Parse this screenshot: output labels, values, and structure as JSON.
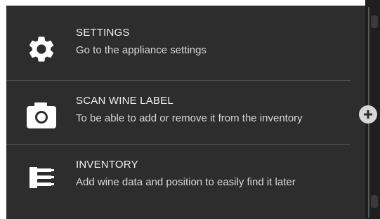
{
  "menu": {
    "items": [
      {
        "id": "settings",
        "title": "SETTINGS",
        "description": "Go to the appliance settings",
        "icon": "gear-icon"
      },
      {
        "id": "scan",
        "title": "SCAN WINE LABEL",
        "description": "To be able to add or remove it from the inventory",
        "icon": "camera-icon"
      },
      {
        "id": "inventory",
        "title": "INVENTORY",
        "description": "Add wine data and position to easily find it later",
        "icon": "wine-rack-icon"
      }
    ]
  },
  "side_control": {
    "icon": "plus-icon"
  },
  "colors": {
    "panel_bg": "#2d2d2d",
    "text": "#f1f1f1",
    "divider": "#555555",
    "accent_button": "#d6d6d6"
  }
}
